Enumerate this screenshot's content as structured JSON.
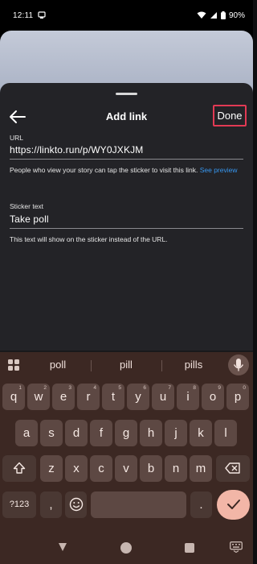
{
  "status_bar": {
    "time": "12:11",
    "battery": "90%"
  },
  "sheet": {
    "title": "Add link",
    "done_label": "Done",
    "url_field": {
      "label": "URL",
      "value": "https://linkto.run/p/WY0JXKJM",
      "helper": "People who view your story can tap the sticker to visit this link.",
      "helper_link": "See preview"
    },
    "sticker_field": {
      "label": "Sticker text",
      "value": "Take poll",
      "helper": "This text will show on the sticker instead of the URL."
    }
  },
  "keyboard": {
    "suggestions": [
      "poll",
      "pill",
      "pills"
    ],
    "row1": [
      {
        "k": "q",
        "h": "1"
      },
      {
        "k": "w",
        "h": "2"
      },
      {
        "k": "e",
        "h": "3"
      },
      {
        "k": "r",
        "h": "4"
      },
      {
        "k": "t",
        "h": "5"
      },
      {
        "k": "y",
        "h": "6"
      },
      {
        "k": "u",
        "h": "7"
      },
      {
        "k": "i",
        "h": "8"
      },
      {
        "k": "o",
        "h": "9"
      },
      {
        "k": "p",
        "h": "0"
      }
    ],
    "row2": [
      "a",
      "s",
      "d",
      "f",
      "g",
      "h",
      "j",
      "k",
      "l"
    ],
    "row3": [
      "z",
      "x",
      "c",
      "v",
      "b",
      "n",
      "m"
    ],
    "symbols_label": "?123",
    "comma_label": ",",
    "period_label": "."
  },
  "colors": {
    "sheet_bg": "#232327",
    "done_border": "#e23a54",
    "link_blue": "#3797f0",
    "keyboard_bg": "#3c2823",
    "key_bg": "#5d4843",
    "enter_key": "#f2b6a7"
  },
  "icons": {
    "back": "arrow-left-icon",
    "mic": "microphone-icon",
    "shift": "shift-icon",
    "backspace": "backspace-icon",
    "emoji": "emoji-icon",
    "enter": "checkmark-icon",
    "grid": "apps-grid-icon"
  }
}
